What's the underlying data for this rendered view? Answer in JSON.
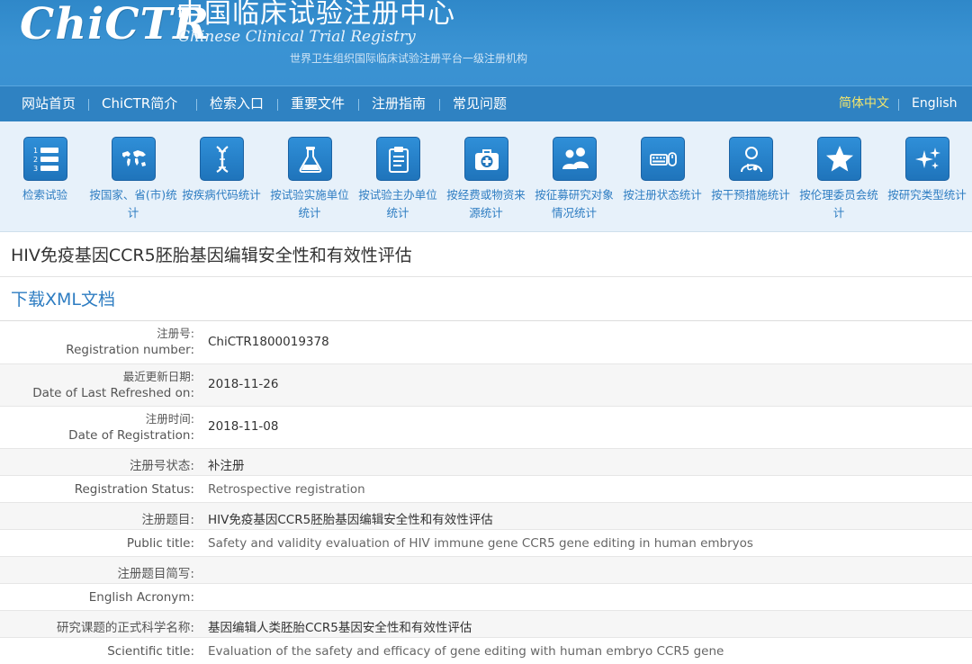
{
  "header": {
    "logo_text": "ChiCTR",
    "org_cn": "中国临床试验注册中心",
    "org_en": "Chinese Clinical Trial Registry",
    "tagline": "世界卫生组织国际临床试验注册平台一级注册机构",
    "brand_color": "#3a91d2"
  },
  "nav": {
    "items": [
      "网站首页",
      "ChiCTR简介",
      "检索入口",
      "重要文件",
      "注册指南",
      "常见问题"
    ],
    "lang_cn": "简体中文",
    "lang_en": "English"
  },
  "icon_bar": {
    "items": [
      {
        "label": "检索试验",
        "icon": "list-icon"
      },
      {
        "label": "按国家、省(市)统计",
        "icon": "world-map-icon"
      },
      {
        "label": "按疾病代码统计",
        "icon": "dna-icon"
      },
      {
        "label": "按试验实施单位统计",
        "icon": "flask-icon"
      },
      {
        "label": "按试验主办单位统计",
        "icon": "clipboard-icon"
      },
      {
        "label": "按经费或物资来源统计",
        "icon": "medical-kit-icon"
      },
      {
        "label": "按征募研究对象情况统计",
        "icon": "people-icon"
      },
      {
        "label": "按注册状态统计",
        "icon": "keyboard-mouse-icon"
      },
      {
        "label": "按干预措施统计",
        "icon": "doctor-icon"
      },
      {
        "label": "按伦理委员会统计",
        "icon": "star-icon"
      },
      {
        "label": "按研究类型统计",
        "icon": "sparkle-icon"
      }
    ]
  },
  "page": {
    "title": "HIV免疫基因CCR5胚胎基因编辑安全性和有效性评估",
    "xml_link": "下载XML文档"
  },
  "fields": {
    "reg_no_cn": "注册号:",
    "reg_no_en": "Registration number:",
    "reg_no": "ChiCTR1800019378",
    "refreshed_cn": "最近更新日期:",
    "refreshed_en": "Date of Last Refreshed on:",
    "refreshed": "2018-11-26",
    "reg_date_cn": "注册时间:",
    "reg_date_en": "Date of Registration:",
    "reg_date": "2018-11-08",
    "status_cn_label": "注册号状态:",
    "status_cn": "补注册",
    "status_en_label": "Registration Status:",
    "status_en": "Retrospective registration",
    "title_cn_label": "注册题目:",
    "title_cn": "HIV免疫基因CCR5胚胎基因编辑安全性和有效性评估",
    "title_en_label": "Public title:",
    "title_en": "Safety and validity evaluation of HIV immune gene CCR5 gene editing in human embryos",
    "acronym_cn_label": "注册题目简写:",
    "acronym_cn": "",
    "acronym_en_label": "English Acronym:",
    "acronym_en": "",
    "sci_cn_label": "研究课题的正式科学名称:",
    "sci_cn": "基因编辑人类胚胎CCR5基因安全性和有效性评估",
    "sci_en_label": "Scientific title:",
    "sci_en": "Evaluation of the safety and efficacy of gene editing with human embryo CCR5 gene"
  }
}
